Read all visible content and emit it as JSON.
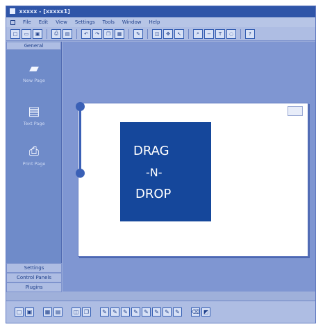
{
  "window": {
    "title": "xxxxx - [xxxxx1]",
    "menu": [
      "File",
      "Edit",
      "View",
      "Settings",
      "Tools",
      "Window",
      "Help"
    ]
  },
  "toolbar": {
    "groups": [
      [
        "new-icon",
        "open-icon",
        "save-icon"
      ],
      [
        "print-icon",
        "preview-icon"
      ],
      [
        "undo-icon",
        "redo-icon",
        "copy-icon",
        "paste-icon"
      ],
      [
        "pen-icon"
      ],
      [
        "select-icon",
        "move-icon",
        "pointer-icon"
      ],
      [
        "zoom-icon",
        "zoom-out-icon",
        "text-icon",
        "lasso-icon"
      ],
      [
        "help-icon"
      ]
    ]
  },
  "sidebar": {
    "tab": "General",
    "items": [
      {
        "icon": "new-page-icon",
        "label": "New Page"
      },
      {
        "icon": "text-page-icon",
        "label": "Text Page"
      },
      {
        "icon": "print-page-icon",
        "label": "Print Page"
      }
    ],
    "bottom": [
      "Settings",
      "Control Panels",
      "Plugins"
    ]
  },
  "canvas": {
    "handwriting_lines": [
      "DRAG",
      "-N-",
      "DROP"
    ]
  },
  "bottombar": {
    "groups": [
      [
        "page-icon",
        "save-page-icon"
      ],
      [
        "layers-icon",
        "thumbs-icon"
      ],
      [
        "select-icon",
        "copy-icon"
      ],
      [
        "pen-1-icon",
        "pen-2-icon",
        "pen-3-icon",
        "pen-4-icon",
        "pen-5-icon",
        "pen-6-icon",
        "pen-7-icon",
        "pen-8-icon"
      ],
      [
        "eraser-icon",
        "color-icon"
      ]
    ]
  },
  "colors": {
    "accent": "#2f55a8",
    "workspace": "#7f96d2",
    "drag_box": "#15479b"
  }
}
